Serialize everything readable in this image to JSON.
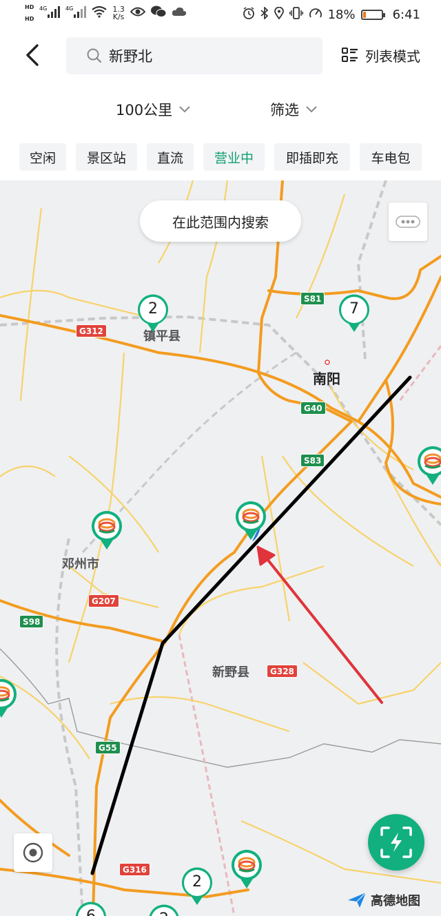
{
  "status_bar": {
    "hd1": "HD",
    "hd2": "HD",
    "sig1": "4G",
    "sig2": "4G",
    "net_speed_value": "1.3",
    "net_speed_unit": "K/s",
    "battery_percent_text": "18%",
    "battery_level": 0.18,
    "time": "6:41"
  },
  "header": {
    "search_value": "新野北",
    "list_mode_label": "列表模式"
  },
  "filters": {
    "distance_label": "100公里",
    "filter_label": "筛选"
  },
  "chips": [
    {
      "label": "空闲",
      "active": false
    },
    {
      "label": "景区站",
      "active": false
    },
    {
      "label": "直流",
      "active": false
    },
    {
      "label": "营业中",
      "active": true
    },
    {
      "label": "即插即充",
      "active": false
    },
    {
      "label": "车电包",
      "active": false
    }
  ],
  "map": {
    "search_area_label": "在此范围内搜索",
    "places": {
      "nanyang": "南阳",
      "zhenping": "镇平县",
      "dengzhou": "邓州市",
      "xinye": "新野县"
    },
    "road_shields": {
      "s81": "S81",
      "g312": "G312",
      "g40": "G40",
      "s83": "S83",
      "s98": "S98",
      "g207": "G207",
      "g328": "G328",
      "g55": "G55",
      "g316": "G316"
    },
    "cluster_counts": {
      "zhenping": "2",
      "nanyang": "7",
      "bottom": "2",
      "bottom_left": "6",
      "bottom_mid": "2"
    },
    "brand_name": "高德地图",
    "colors": {
      "accent_green": "#12b07f",
      "highway_orange": "#f39c1f",
      "road_yellow": "#f7d36a",
      "annotation_black": "#000000",
      "annotation_red": "#e0333b"
    }
  }
}
